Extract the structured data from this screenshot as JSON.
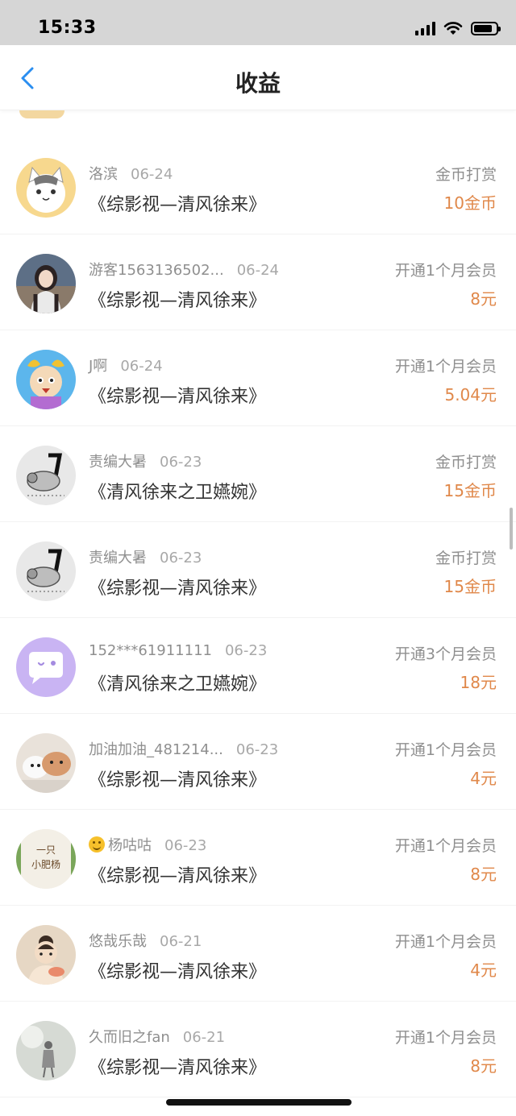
{
  "status_bar": {
    "time": "15:33"
  },
  "header": {
    "title": "收益",
    "back_icon": "chevron-left-icon",
    "accent": "#2b8ef0"
  },
  "colors": {
    "amount": "#e0884a",
    "meta": "#8f8f8f"
  },
  "records": [
    {
      "user": "洛滨",
      "date": "06-24",
      "book": "《综影视—清风徐来》",
      "type": "金币打赏",
      "amount": "10金币",
      "avatar": "cat-avatar"
    },
    {
      "user": "游客1563136502...",
      "date": "06-24",
      "book": "《综影视—清风徐来》",
      "type": "开通1个月会员",
      "amount": "8元",
      "avatar": "girl-photo-avatar"
    },
    {
      "user": "J啊",
      "date": "06-24",
      "book": "《综影视—清风徐来》",
      "type": "开通1个月会员",
      "amount": "5.04元",
      "avatar": "cartoon-girl-avatar"
    },
    {
      "user": "责编大暑",
      "date": "06-23",
      "book": "《清风徐来之卫嬿婉》",
      "type": "金币打赏",
      "amount": "15金币",
      "avatar": "sketch-animal-avatar"
    },
    {
      "user": "责编大暑",
      "date": "06-23",
      "book": "《综影视—清风徐来》",
      "type": "金币打赏",
      "amount": "15金币",
      "avatar": "sketch-animal-avatar"
    },
    {
      "user": "152***61911111",
      "date": "06-23",
      "book": "《清风徐来之卫嬿婉》",
      "type": "开通3个月会员",
      "amount": "18元",
      "avatar": "chat-bubble-avatar"
    },
    {
      "user": "加油加油_481214...",
      "date": "06-23",
      "book": "《综影视—清风徐来》",
      "type": "开通1个月会员",
      "amount": "4元",
      "avatar": "pets-photo-avatar"
    },
    {
      "user": "杨咕咕",
      "user_emoji": "grinning-face-emoji",
      "date": "06-23",
      "book": "《综影视—清风徐来》",
      "type": "开通1个月会员",
      "amount": "8元",
      "avatar": "text-logo-avatar",
      "avatar_text": "一只\n小肥杨"
    },
    {
      "user": "悠哉乐哉",
      "date": "06-21",
      "book": "《综影视—清风徐来》",
      "type": "开通1个月会员",
      "amount": "4元",
      "avatar": "illustration-avatar"
    },
    {
      "user": "久而旧之fan",
      "date": "06-21",
      "book": "《综影视—清风徐来》",
      "type": "开通1个月会员",
      "amount": "8元",
      "avatar": "grey-figure-avatar"
    }
  ]
}
